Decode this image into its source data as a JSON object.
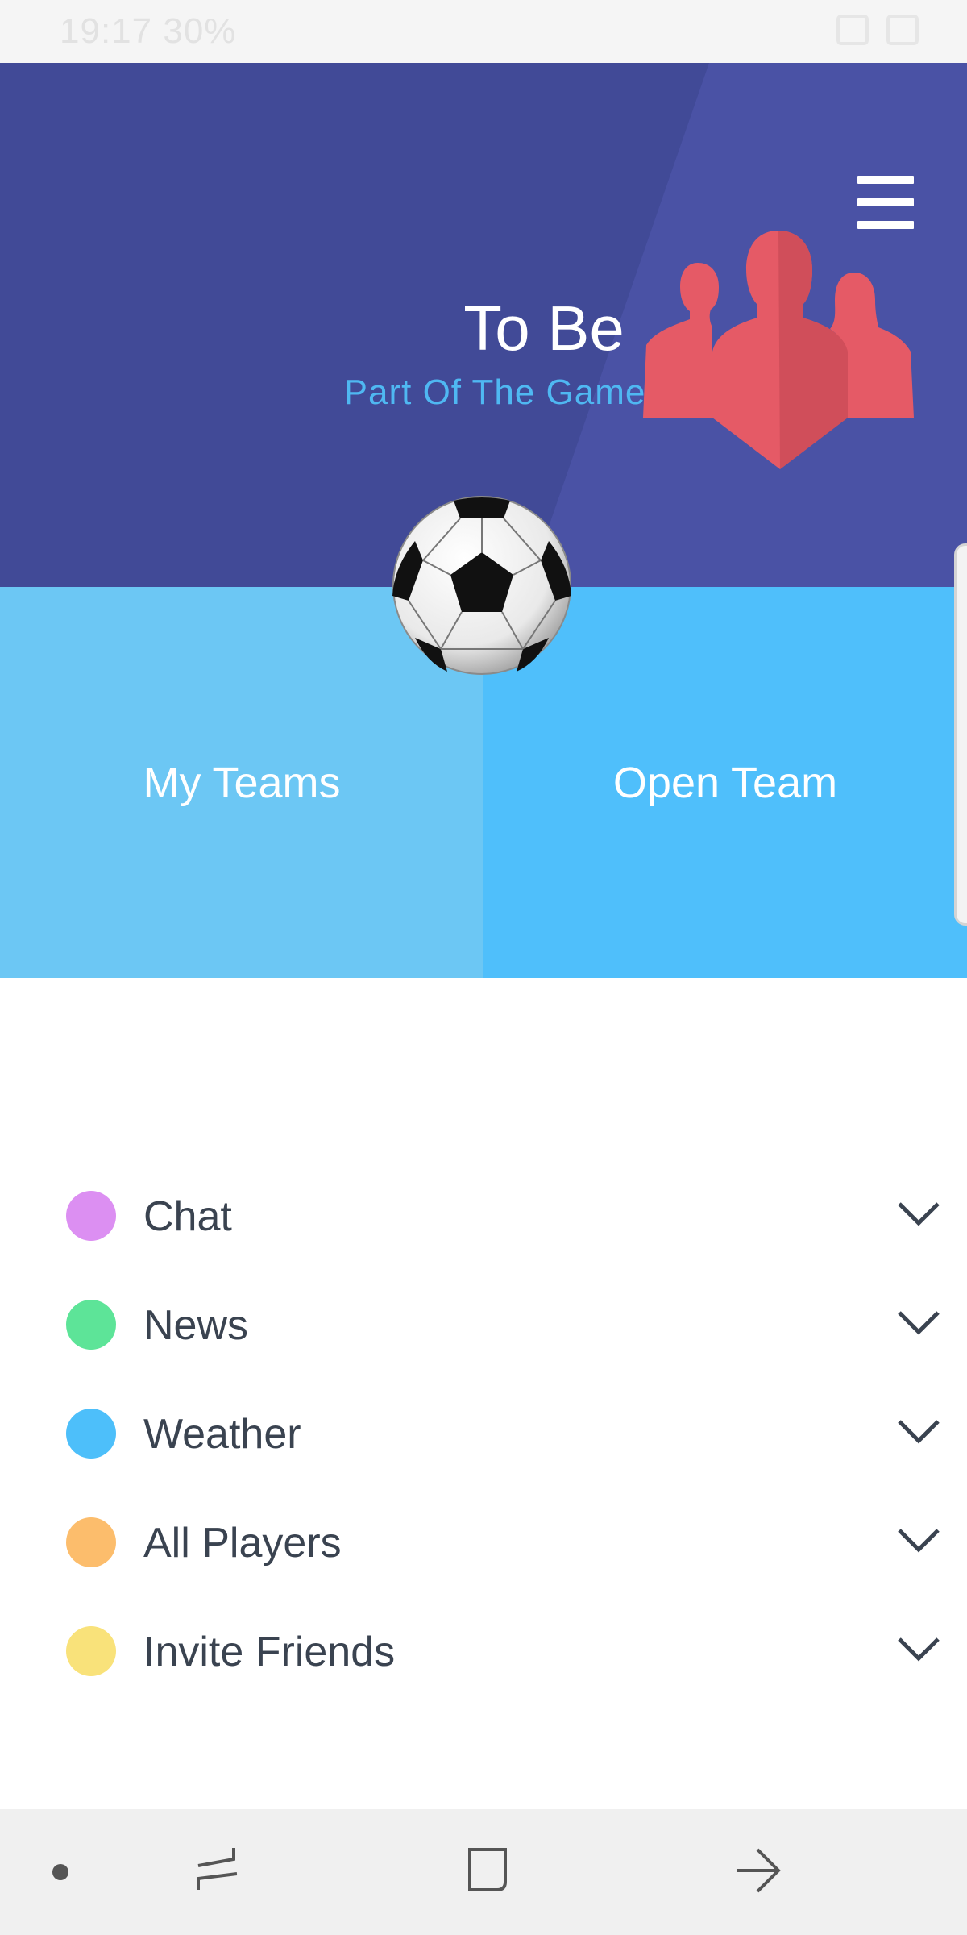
{
  "status_bar": {
    "time": "19:17",
    "battery": "30%"
  },
  "header": {
    "title": "To Be",
    "subtitle": "Part Of The Game",
    "menu_icon": "hamburger-menu-icon",
    "illustration_icon": "team-people-icon",
    "ball_icon": "soccer-ball-icon"
  },
  "tiles": [
    {
      "label": "My Teams"
    },
    {
      "label": "Open Team"
    }
  ],
  "menu": {
    "items": [
      {
        "label": "Chat",
        "color": "#dc8ff2"
      },
      {
        "label": "News",
        "color": "#5de498"
      },
      {
        "label": "Weather",
        "color": "#4dbffa"
      },
      {
        "label": "All Players",
        "color": "#fcbd6c"
      },
      {
        "label": "Invite Friends",
        "color": "#f9e27a"
      }
    ]
  },
  "colors": {
    "header_bg": "#414a97",
    "header_bg_light": "#4a52a5",
    "tile_left": "#6cc7f4",
    "tile_right": "#4fbffb",
    "accent_subtitle": "#4fb8f2",
    "people_icon": "#e55a66"
  },
  "nav_bar": {
    "icons": [
      "recent-apps-icon",
      "home-icon",
      "back-icon"
    ]
  }
}
